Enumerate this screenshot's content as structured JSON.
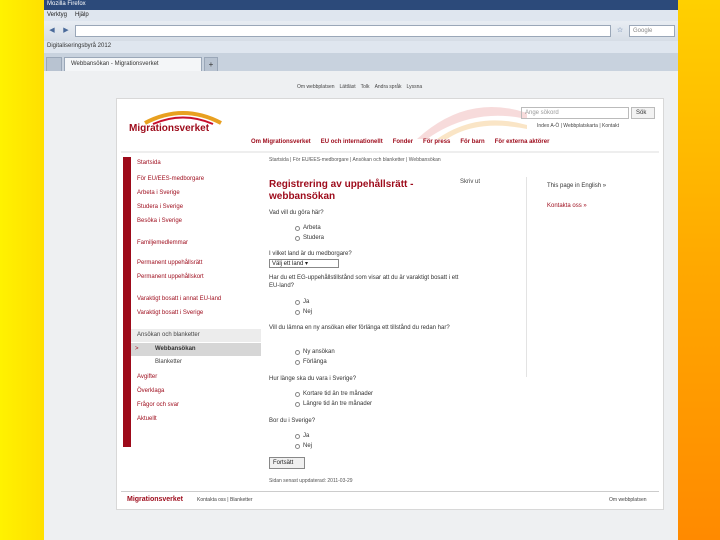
{
  "browser": {
    "title": "Mozilla Firefox",
    "menu": [
      "Verktyg",
      "Hjälp"
    ],
    "url": "",
    "bookmark_text": "Digitaliseringsbyrå 2012",
    "tabs": [
      "Webbansökan - Migrationsverket"
    ],
    "search_placeholder": "Google",
    "new_tab": "+"
  },
  "site": {
    "logo": "Migrationsverket",
    "top_links": [
      "Om webbplatsen",
      "Lättläst",
      "Tolk",
      "Andra språk",
      "Lyssna"
    ],
    "search_placeholder": "Ange sökord",
    "search_button": "Sök",
    "util_links": "Index A-Ö | Webbplatskarta | Kontakt",
    "main_nav": [
      "Om Migrationsverket",
      "EU och internationellt",
      "Fonder",
      "För press",
      "För barn",
      "För externa aktörer"
    ]
  },
  "sidebar": {
    "items": [
      {
        "label": "Startsida",
        "kind": "top"
      },
      {
        "label": "För EU/EES-medborgare",
        "kind": "top"
      },
      {
        "label": "Arbeta i Sverige",
        "kind": "top"
      },
      {
        "label": "Studera i Sverige",
        "kind": "top"
      },
      {
        "label": "Besöka i Sverige",
        "kind": "top"
      },
      {
        "label": "Familjemedlemmar",
        "kind": "top"
      },
      {
        "label": "Permanent uppehållsrätt",
        "kind": "top"
      },
      {
        "label": "Permanent uppehållskort",
        "kind": "top"
      },
      {
        "label": "Varaktigt bosatt i annat EU-land",
        "kind": "top"
      },
      {
        "label": "Varaktigt bosatt i Sverige",
        "kind": "top"
      },
      {
        "label": "Ansökan och blanketter",
        "kind": "shade"
      },
      {
        "label": "Webbansökan",
        "kind": "current"
      },
      {
        "label": "Blanketter",
        "kind": "sub"
      },
      {
        "label": "Avgifter",
        "kind": "top"
      },
      {
        "label": "Överklaga",
        "kind": "top"
      },
      {
        "label": "Frågor och svar",
        "kind": "top"
      },
      {
        "label": "Aktuellt",
        "kind": "top"
      }
    ],
    "arrow": ">"
  },
  "content": {
    "breadcrumb": "Startsida | För EU/EES-medborgare | Ansökan och blanketter | Webbansökan",
    "title": "Registrering av uppehållsrätt - webbansökan",
    "print": "Skriv ut",
    "english_link": "This page in English",
    "contact": "Kontakta oss",
    "q1": "Vad vill du göra här?",
    "q1_opts": [
      "Arbeta",
      "Studera"
    ],
    "q2": "I vilket land är du medborgare?",
    "select_value": "Välj ett land",
    "q3": "Har du ett EG-uppehållstillstånd som visar att du är varaktigt bosatt i ett EU-land?",
    "q3_opts": [
      "Ja",
      "Nej"
    ],
    "q4": "Vill du lämna en ny ansökan eller förlänga ett tillstånd du redan har?",
    "q4_opts": [
      "Ny ansökan",
      "Förlänga"
    ],
    "q5": "Hur länge ska du vara i Sverige?",
    "q5_opts": [
      "Kortare tid än tre månader",
      "Längre tid än tre månader"
    ],
    "q6": "Bor du i Sverige?",
    "q6_opts": [
      "Ja",
      "Nej"
    ],
    "submit": "Fortsätt",
    "updated": "Sidan senast uppdaterad: 2011-03-29"
  },
  "footer": {
    "logo": "Migrationsverket",
    "links": "Kontakta oss | Blanketter",
    "right": "Om webbplatsen"
  }
}
